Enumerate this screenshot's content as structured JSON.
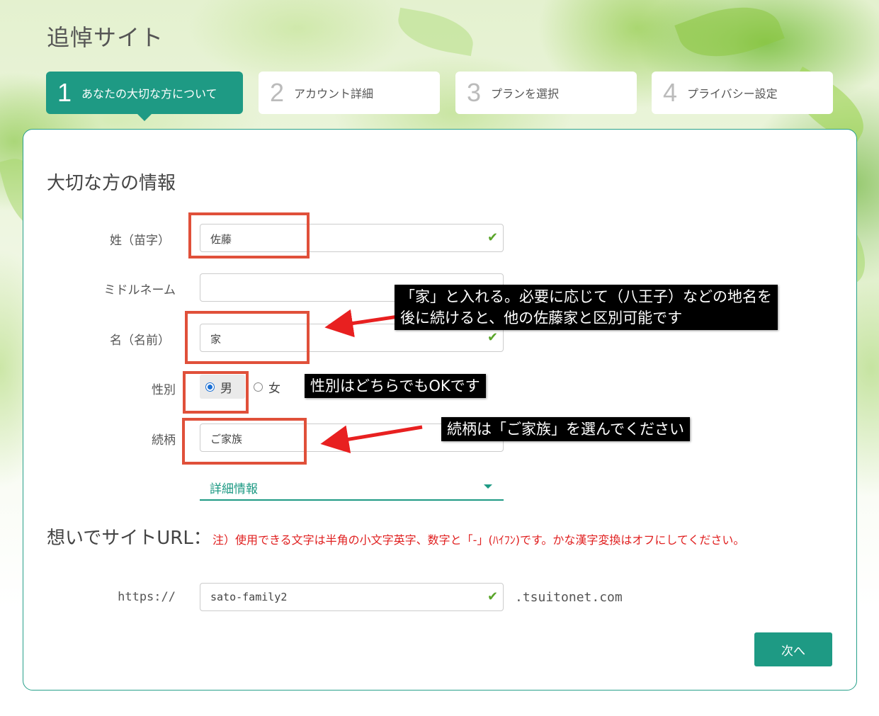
{
  "site": {
    "title": "追悼サイト"
  },
  "steps": [
    {
      "num": "1",
      "label": "あなたの大切な方について"
    },
    {
      "num": "2",
      "label": "アカウント詳細"
    },
    {
      "num": "3",
      "label": "プランを選択"
    },
    {
      "num": "4",
      "label": "プライバシー設定"
    }
  ],
  "form": {
    "section_title": "大切な方の情報",
    "surname": {
      "label": "姓（苗字）",
      "value": "佐藤"
    },
    "middle": {
      "label": "ミドルネーム",
      "value": ""
    },
    "given": {
      "label": "名（名前）",
      "value": "家"
    },
    "gender": {
      "label": "性別",
      "option_male": "男",
      "option_female": "女",
      "selected": "男"
    },
    "relation": {
      "label": "続柄",
      "value": "ご家族"
    },
    "details_label": "詳細情報"
  },
  "url": {
    "title": "想いでサイトURL：",
    "note": "注）使用できる文字は半角の小文字英字、数字と「-」(ﾊｲﾌﾝ)です。かな漢字変換はオフにしてください。",
    "prefix": "https://",
    "value": "sato-family2",
    "suffix": ".tsuitonet.com"
  },
  "next_button": "次へ",
  "annotations": {
    "callout_given_line1": "「家」と入れる。必要に応じて（八王子）などの地名を",
    "callout_given_line2": "後に続けると、他の佐藤家と区別可能です",
    "callout_gender": "性別はどちらでもOKです",
    "callout_relation": "続柄は「ご家族」を選んでください"
  },
  "colors": {
    "accent": "#1e9a84",
    "annotation_box": "#e0503a",
    "arrow": "#e82020",
    "note_red": "#e02020",
    "check": "#5aa52a"
  }
}
